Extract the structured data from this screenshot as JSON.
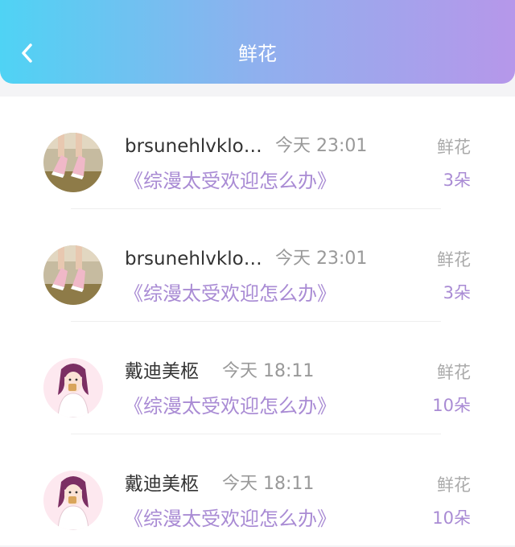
{
  "header": {
    "title": "鲜花",
    "back_icon": "chevron-left-icon",
    "gradient": [
      "#4fd3f4",
      "#b697ea"
    ]
  },
  "accent_color": "#a98bd4",
  "items": [
    {
      "name": "brsunehlvklo…",
      "time": "今天 23:01",
      "book": "《综漫太受欢迎怎么办》",
      "gift_label": "鲜花",
      "gift_count": "3朵",
      "avatar": "shoes-photo-avatar"
    },
    {
      "name": "brsunehlvklo…",
      "time": "今天 23:01",
      "book": "《综漫太受欢迎怎么办》",
      "gift_label": "鲜花",
      "gift_count": "3朵",
      "avatar": "shoes-photo-avatar"
    },
    {
      "name": "戴迪美柩",
      "time": "今天 18:11",
      "book": "《综漫太受欢迎怎么办》",
      "gift_label": "鲜花",
      "gift_count": "10朵",
      "avatar": "girl-illustration-avatar"
    },
    {
      "name": "戴迪美柩",
      "time": "今天 18:11",
      "book": "《综漫太受欢迎怎么办》",
      "gift_label": "鲜花",
      "gift_count": "10朵",
      "avatar": "girl-illustration-avatar"
    }
  ]
}
